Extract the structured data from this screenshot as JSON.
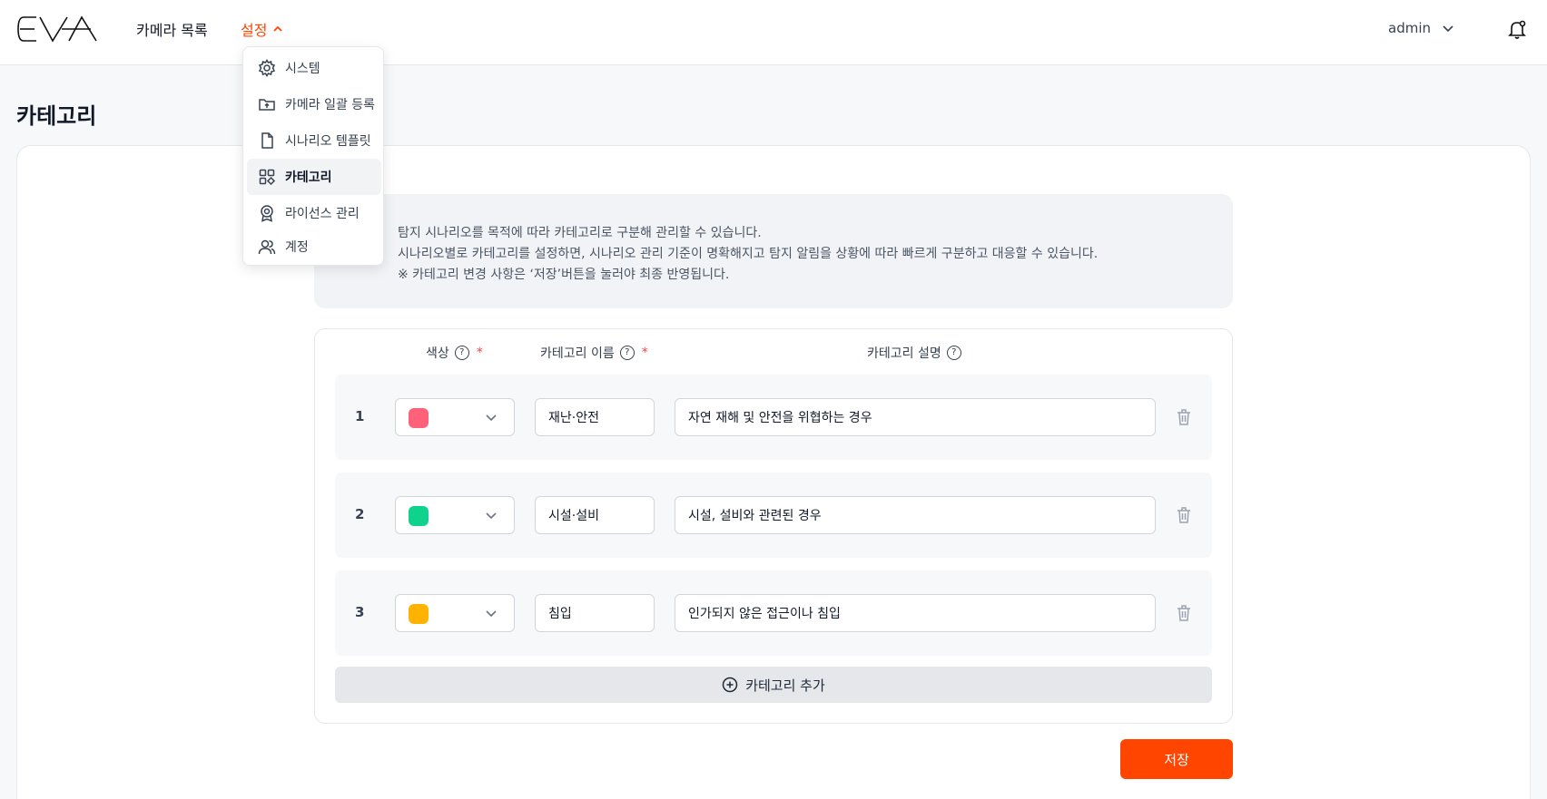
{
  "header": {
    "logo_alt": "EVA",
    "nav": [
      {
        "label": "카메라 목록"
      },
      {
        "label": "설정"
      }
    ],
    "user": "admin"
  },
  "settings_menu": {
    "items": [
      {
        "label": "시스템",
        "icon": "gear-icon"
      },
      {
        "label": "카메라 일괄 등록",
        "icon": "folder-upload-icon"
      },
      {
        "label": "시나리오 템플릿",
        "icon": "file-icon"
      },
      {
        "label": "카테고리",
        "icon": "category-grid-icon",
        "active": true
      },
      {
        "label": "라이선스 관리",
        "icon": "badge-icon"
      },
      {
        "label": "계정",
        "icon": "users-icon"
      }
    ]
  },
  "page": {
    "title": "카테고리"
  },
  "info": {
    "lines": [
      "탐지 시나리오를 목적에 따라 카테고리로 구분해 관리할 수 있습니다.",
      "시나리오별로 카테고리를 설정하면, 시나리오 관리 기준이 명확해지고 탐지 알림을 상황에 따라 빠르게 구분하고 대응할 수 있습니다.",
      "※ 카테고리 변경 사항은 ‘저장’버튼을 눌러야 최종 반영됩니다."
    ]
  },
  "table": {
    "columns": {
      "color": "색상",
      "name": "카테고리 이름",
      "description": "카테고리 설명",
      "required_mark": "*",
      "help_mark": "?"
    },
    "rows": [
      {
        "num": "1",
        "color": "#ff6179",
        "name": "재난·안전",
        "description": "자연 재해 및 안전을 위협하는 경우"
      },
      {
        "num": "2",
        "color": "#0fd38c",
        "name": "시설·설비",
        "description": "시설, 설비와 관련된 경우"
      },
      {
        "num": "3",
        "color": "#ffb300",
        "name": "침입",
        "description": "인가되지 않은 접근이나 침입"
      }
    ],
    "add_label": "카테고리 추가"
  },
  "save_label": "저장",
  "colors": {
    "accent": "#ff4500",
    "info_bg": "#f1f3f7",
    "required": "#ef4444"
  }
}
